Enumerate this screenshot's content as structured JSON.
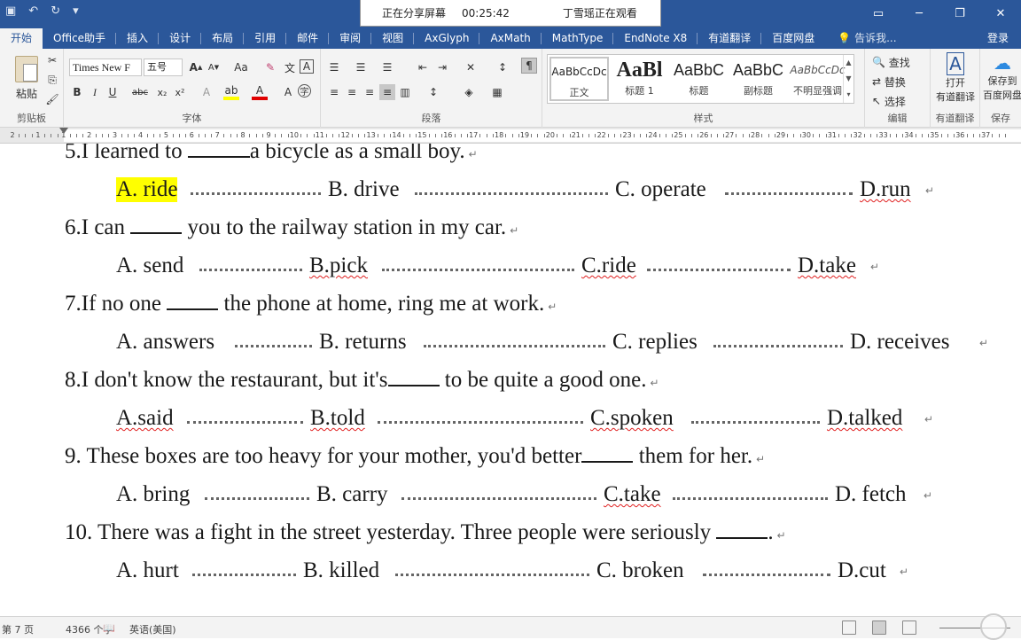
{
  "screen_share": {
    "status": "正在分享屏幕",
    "time": "00:25:42",
    "viewer": "丁雪瑶正在观看"
  },
  "ribbon_tabs": [
    "开始",
    "Office助手",
    "插入",
    "设计",
    "布局",
    "引用",
    "邮件",
    "审阅",
    "视图",
    "AxGlyph",
    "AxMath",
    "MathType",
    "EndNote X8",
    "有道翻译",
    "百度网盘"
  ],
  "active_tab": "开始",
  "tell_me": "告诉我...",
  "login": "登录",
  "clipboard": {
    "paste": "粘贴",
    "label": "剪贴板"
  },
  "font": {
    "name": "Times New F",
    "size": "五号",
    "label": "字体",
    "aa": "Aa"
  },
  "paragraph": {
    "label": "段落"
  },
  "styles": {
    "label": "样式",
    "items": [
      {
        "sample": "AaBbCcDc",
        "name": "正文"
      },
      {
        "sample": "AaBl",
        "name": "标题 1"
      },
      {
        "sample": "AaBbC",
        "name": "标题"
      },
      {
        "sample": "AaBbC",
        "name": "副标题"
      },
      {
        "sample": "AaBbCcDc",
        "name": "不明显强调"
      }
    ]
  },
  "editing": {
    "find": "查找",
    "replace": "替换",
    "select": "选择",
    "label": "编辑"
  },
  "youdao": {
    "open": "打开",
    "translate": "有道翻译",
    "label": "有道翻译"
  },
  "baidu": {
    "save": "保存到",
    "pan": "百度网盘",
    "label": "保存"
  },
  "ruler_numbers": [
    "2",
    "1",
    "1",
    "2",
    "3",
    "4",
    "5",
    "6",
    "7",
    "8",
    "9",
    "10",
    "11",
    "12",
    "13",
    "14",
    "15",
    "16",
    "17",
    "18",
    "19",
    "20",
    "21",
    "22",
    "23",
    "24",
    "25",
    "26",
    "27",
    "28",
    "29",
    "30",
    "31",
    "32",
    "33",
    "34",
    "35",
    "36",
    "37"
  ],
  "document": {
    "questions": [
      {
        "stem_pre": "5.I learned to ",
        "stem_post": "a bicycle as a small boy.",
        "options": [
          "A. ride",
          "B. drive",
          "C. operate",
          "D.run"
        ]
      },
      {
        "stem_pre": "6.I can ",
        "stem_post": " you to the railway station in my car.",
        "options": [
          "A. send",
          "B.pick",
          "C.ride",
          "D.take"
        ]
      },
      {
        "stem_pre": "7.If no one ",
        "stem_post": " the phone at home, ring me at work.",
        "options": [
          "A. answers",
          "B. returns",
          "C. replies",
          "D. receives"
        ]
      },
      {
        "stem_pre": "8.I don't know the restaurant, but it's",
        "stem_post": " to be quite a good one.",
        "options": [
          "A.said",
          "B.told",
          "C.spoken",
          "D.talked"
        ]
      },
      {
        "stem_pre": "9. These boxes are too heavy for your mother, you'd better",
        "stem_post": " them for her.",
        "options": [
          "A. bring",
          "B. carry",
          "C.take",
          "D. fetch"
        ]
      },
      {
        "stem_pre": "10. There was a fight in the street yesterday. Three people were seriously ",
        "stem_post": ".",
        "options": [
          "A. hurt",
          "B. killed",
          "C. broken",
          "D.cut"
        ]
      }
    ],
    "highlight_color": "#ffff00"
  },
  "statusbar": {
    "page": "第 7 页",
    "words": "4366 个字",
    "language": "英语(美国)"
  }
}
